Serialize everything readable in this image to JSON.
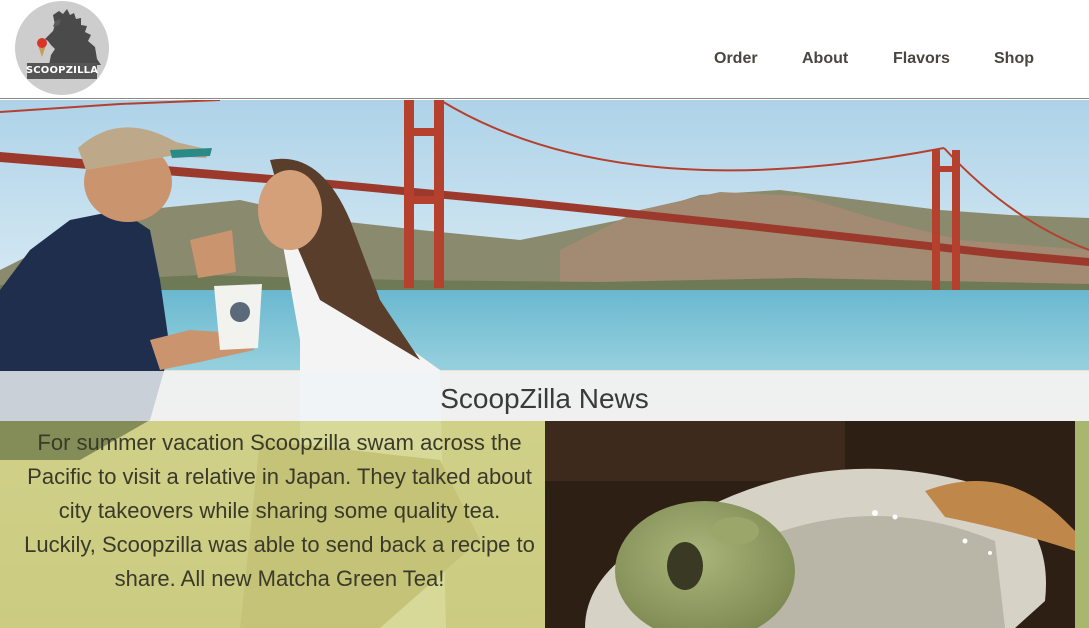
{
  "brand": {
    "logo_text": "SCOOPZILLA"
  },
  "nav": {
    "items": [
      {
        "label": "Order"
      },
      {
        "label": "About"
      },
      {
        "label": "Flavors"
      },
      {
        "label": "Shop"
      }
    ]
  },
  "news": {
    "title": "ScoopZilla News",
    "story": "For summer vacation Scoopzilla swam across the Pacific to visit a relative in Japan. They talked about city takeovers while sharing some quality tea. Luckily, Scoopzilla was able to send back a recipe to share. All new Matcha Green Tea!"
  },
  "colors": {
    "nav_text": "#4a4540",
    "story_panel": "#c4c860",
    "bridge": "#b5402e"
  }
}
